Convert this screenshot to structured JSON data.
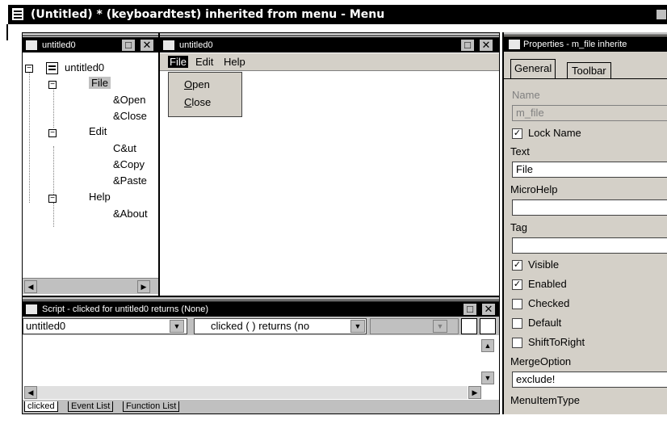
{
  "main_window": {
    "title": "(Untitled) * (keyboardtest) inherited from menu - Menu"
  },
  "tree_panel": {
    "title": "untitled0",
    "items": [
      {
        "label": "untitled0"
      },
      {
        "label": "File"
      },
      {
        "label": "&Open"
      },
      {
        "label": "&Close"
      },
      {
        "label": "Edit"
      },
      {
        "label": "C&ut"
      },
      {
        "label": "&Copy"
      },
      {
        "label": "&Paste"
      },
      {
        "label": "Help"
      },
      {
        "label": "&About"
      }
    ]
  },
  "preview_panel": {
    "title": "untitled0",
    "menubar": [
      "File",
      "Edit",
      "Help"
    ],
    "dropdown": {
      "open_mnemonic": "O",
      "open_rest": "pen",
      "close_mnemonic": "C",
      "close_rest": "lose"
    }
  },
  "script_panel": {
    "title": "Script - clicked for untitled0 returns (None)",
    "object_select": "untitled0",
    "event_select": "clicked ( ) returns (no",
    "tabs": [
      "clicked",
      "Event List",
      "Function List"
    ]
  },
  "properties_panel": {
    "title": "Properties - m_file inherite",
    "tabs": [
      "General",
      "Toolbar"
    ],
    "name_label": "Name",
    "name_value": "m_file",
    "lock_name_label": "Lock Name",
    "lock_name": true,
    "text_label": "Text",
    "text_value": "File",
    "microhelp_label": "MicroHelp",
    "microhelp_value": "",
    "tag_label": "Tag",
    "tag_value": "",
    "checkboxes": [
      {
        "label": "Visible",
        "checked": true
      },
      {
        "label": "Enabled",
        "checked": true
      },
      {
        "label": "Checked",
        "checked": false
      },
      {
        "label": "Default",
        "checked": false
      },
      {
        "label": "ShiftToRight",
        "checked": false
      }
    ],
    "mergeoption_label": "MergeOption",
    "mergeoption_value": "exclude!",
    "menuitemtype_label": "MenuItemType"
  }
}
